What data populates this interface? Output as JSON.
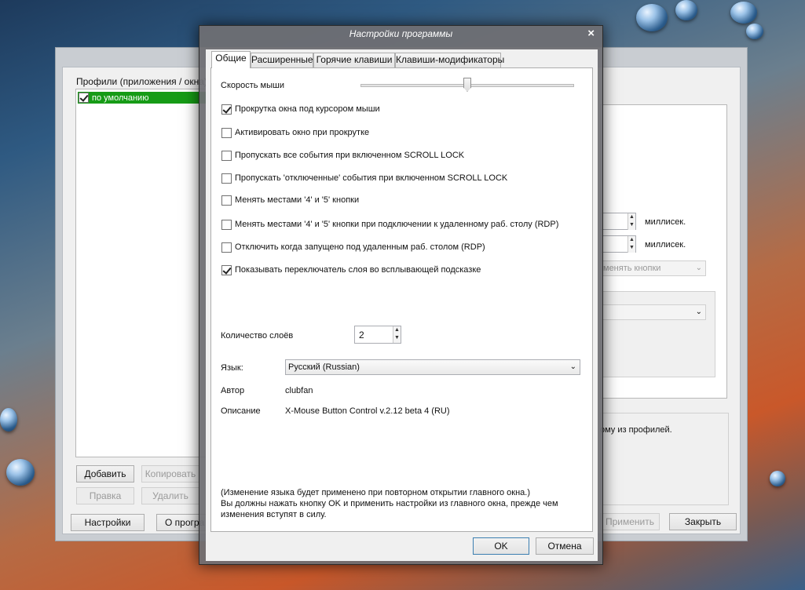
{
  "main": {
    "profiles_label": "Профили (приложения / окна)",
    "profile_default": "по умолчанию",
    "add": "Добавить",
    "copy": "Копировать",
    "edit": "Правка",
    "delete": "Удалить",
    "settings": "Настройки",
    "about": "О програ",
    "apply": "Применить",
    "close": "Закрыть",
    "ms1": "миллисек.",
    "ms2": "миллисек.",
    "swap_partial": "менять кнопки",
    "profile_partial": "ому из профилей."
  },
  "dialog": {
    "title": "Настройки программы",
    "close_glyph": "×",
    "tabs": [
      "Общие",
      "Расширенные",
      "Горячие клавиши",
      "Клавиши-модификаторы"
    ],
    "mouse_speed_label": "Скорость мыши",
    "mouse_speed_level": 0.5,
    "options": [
      {
        "label": "Прокрутка окна под курсором мыши",
        "checked": true
      },
      {
        "label": "Активировать окно при прокрутке",
        "checked": false
      },
      {
        "label": "Пропускать все события при включенном SCROLL LOCK",
        "checked": false
      },
      {
        "label": "Пропускать 'отключенные' события при включенном SCROLL LOCK",
        "checked": false
      },
      {
        "label": "Менять местами '4' и '5' кнопки",
        "checked": false
      },
      {
        "label": "Менять местами '4' и '5' кнопки при подключении к удаленному раб. столу (RDP)",
        "checked": false
      },
      {
        "label": "Отключить когда запущено под удаленным раб. столом (RDP)",
        "checked": false
      },
      {
        "label": "Показывать переключатель слоя во всплывающей подсказке",
        "checked": true
      }
    ],
    "layers_label": "Количество слоёв",
    "layers_value": "2",
    "language_label": "Язык:",
    "language_value": "Русский (Russian)",
    "author_label": "Автор",
    "author_value": "clubfan",
    "description_label": "Описание",
    "description_value": "X-Mouse Button Control v.2.12 beta 4 (RU)",
    "note_line1": "(Изменение языка будет применено при повторном открытии главного окна.)",
    "note_line2": "Вы должны нажать кнопку OK и применить настройки из главного окна, прежде чем",
    "note_line3": "изменения вступят в силу.",
    "ok": "OK",
    "cancel": "Отмена"
  }
}
